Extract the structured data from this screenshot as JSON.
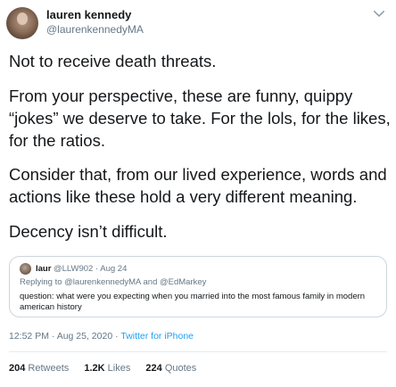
{
  "author": {
    "display_name": "lauren kennedy",
    "handle": "@laurenkennedyMA"
  },
  "tweet": {
    "paragraph_1": "Not to receive death threats.",
    "paragraph_2": "From your perspective, these are funny, quippy “jokes” we deserve to take. For the lols, for the likes, for the ratios.",
    "paragraph_3": "Consider that, from our lived experience, words and actions like these hold a very different meaning.",
    "paragraph_4": "Decency isn’t difficult."
  },
  "quoted_tweet": {
    "name": "laur",
    "handle_date": "@LLW902 · Aug 24",
    "replying_to": "Replying to @laurenkennedyMA and @EdMarkey",
    "text": "question: what were you expecting when you married into the most famous family in modern american history"
  },
  "meta": {
    "timestamp": "12:52 PM · Aug 25, 2020 · ",
    "source": "Twitter for iPhone"
  },
  "stats": {
    "retweets_count": "204",
    "retweets_label": "Retweets",
    "likes_count": "1.2K",
    "likes_label": "Likes",
    "quotes_count": "224",
    "quotes_label": "Quotes"
  },
  "icons": {
    "more": "chevron-down-icon"
  },
  "colors": {
    "text": "#14171a",
    "secondary": "#657786",
    "link": "#1da1f2",
    "border": "#ccd6dd"
  }
}
